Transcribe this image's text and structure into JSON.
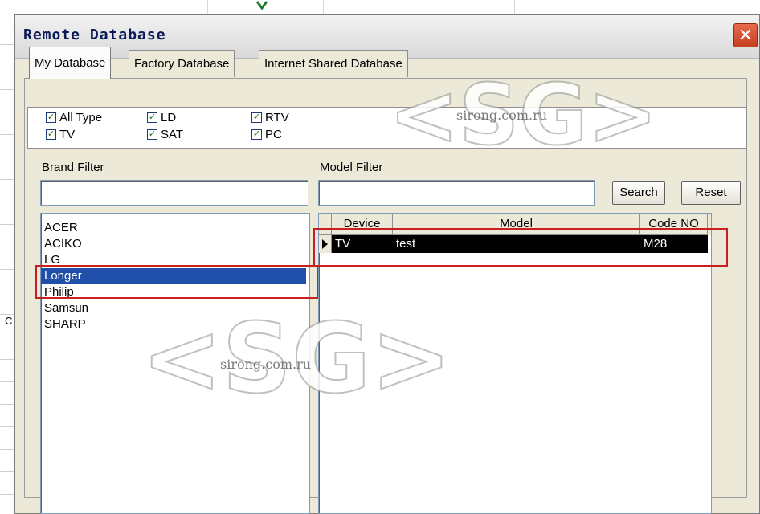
{
  "window": {
    "title": "Remote Database",
    "close_glyph": "✕"
  },
  "tabs": [
    {
      "label": "My Database",
      "active": true
    },
    {
      "label": "Factory Database",
      "active": false
    },
    {
      "label": "Internet Shared Database",
      "active": false
    }
  ],
  "types": [
    {
      "label": "All Type",
      "checked": true
    },
    {
      "label": "LD",
      "checked": true
    },
    {
      "label": "RTV",
      "checked": true
    },
    {
      "label": "TV",
      "checked": true
    },
    {
      "label": "SAT",
      "checked": true
    },
    {
      "label": "PC",
      "checked": true
    }
  ],
  "brand_filter": {
    "label": "Brand Filter",
    "value": ""
  },
  "model_filter": {
    "label": "Model Filter",
    "value": ""
  },
  "buttons": {
    "search": "Search",
    "reset": "Reset"
  },
  "brands": [
    "ACER",
    "ACIKO",
    "LG",
    "Longer",
    "Philip",
    "Samsun",
    "SHARP"
  ],
  "selected_brand": "Longer",
  "model_grid": {
    "columns": [
      "Device",
      "Model",
      "Code NO"
    ],
    "rows": [
      {
        "device": "TV",
        "model": "test",
        "code": "M28"
      }
    ]
  },
  "watermark": {
    "logo": "<SG>",
    "site": "sirong.com.ru"
  },
  "background": {
    "column_marker": "C"
  },
  "colors": {
    "selection": "#1f4fa8",
    "annotation": "#c82020",
    "title_text": "#0b1a57"
  }
}
